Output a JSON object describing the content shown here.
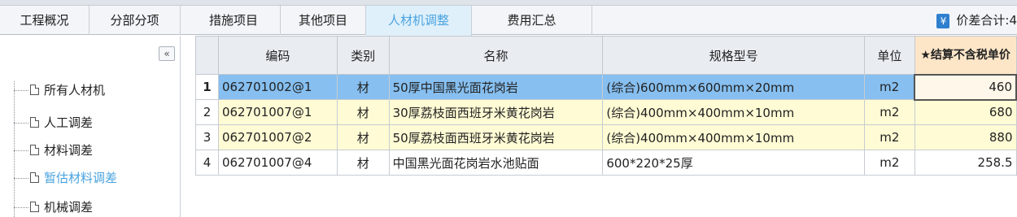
{
  "tabs": [
    {
      "label": "工程概况",
      "active": false
    },
    {
      "label": "分部分项",
      "active": false
    },
    {
      "label": "措施项目",
      "active": false
    },
    {
      "label": "其他项目",
      "active": false
    },
    {
      "label": "人材机调整",
      "active": true
    },
    {
      "label": "费用汇总",
      "active": false
    }
  ],
  "summary": {
    "icon": "yen-icon",
    "label": "价差合计:4"
  },
  "sidebar": {
    "collapse_label": "«",
    "items": [
      {
        "label": "所有人材机",
        "selected": false
      },
      {
        "label": "人工调差",
        "selected": false
      },
      {
        "label": "材料调差",
        "selected": false
      },
      {
        "label": "暂估材料调差",
        "selected": true
      },
      {
        "label": "机械调差",
        "selected": false
      }
    ]
  },
  "grid": {
    "columns": [
      "",
      "编码",
      "类别",
      "名称",
      "规格型号",
      "单位",
      "★结算不含税单价"
    ],
    "rows": [
      {
        "no": "1",
        "code": "062701002@1",
        "type": "材",
        "name": "50厚中国黑光面花岗岩",
        "spec": "(综合)600mm×600mm×20mm",
        "unit": "m2",
        "price": "460",
        "state": "selected"
      },
      {
        "no": "2",
        "code": "062701007@1",
        "type": "材",
        "name": "30厚荔枝面西班牙米黄花岗岩",
        "spec": "(综合)400mm×400mm×10mm",
        "unit": "m2",
        "price": "680",
        "state": "highlight"
      },
      {
        "no": "3",
        "code": "062701007@2",
        "type": "材",
        "name": "50厚荔枝面西班牙米黄花岗岩",
        "spec": "(综合)400mm×400mm×10mm",
        "unit": "m2",
        "price": "880",
        "state": "highlight"
      },
      {
        "no": "4",
        "code": "062701007@4",
        "type": "材",
        "name": "中国黑光面花岗岩水池贴面",
        "spec": "600*220*25厚",
        "unit": "m2",
        "price": "258.5",
        "state": "normal"
      }
    ]
  }
}
